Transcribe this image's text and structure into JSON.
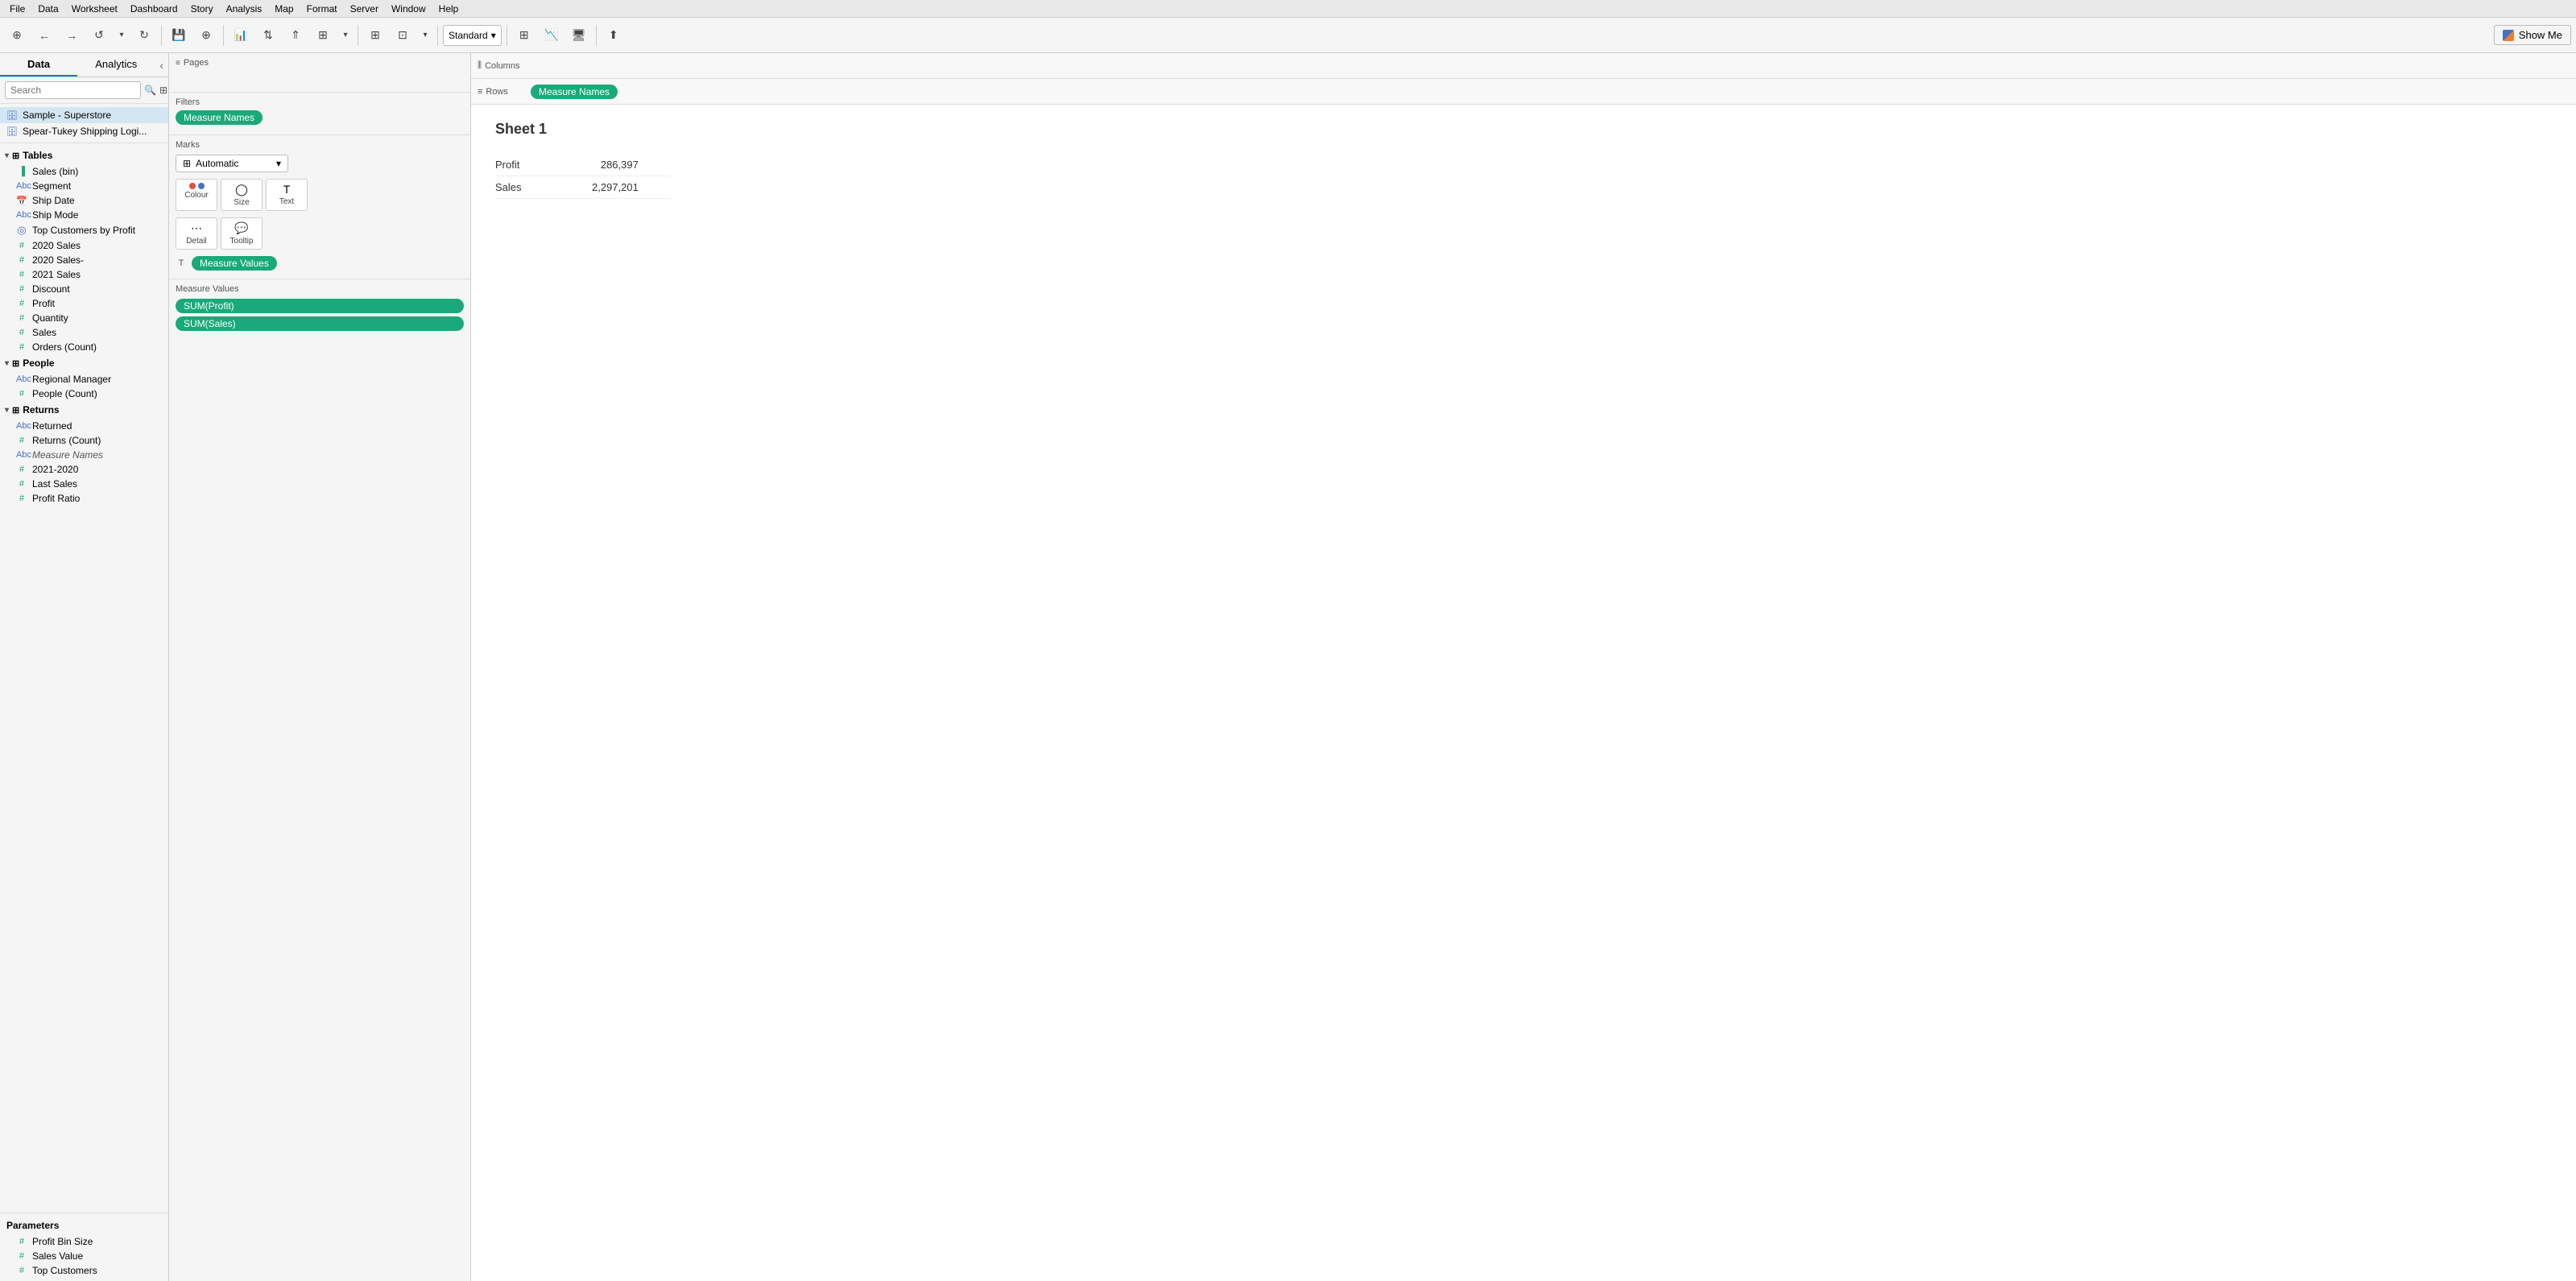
{
  "menubar": {
    "items": [
      "File",
      "Data",
      "Worksheet",
      "Dashboard",
      "Story",
      "Analysis",
      "Map",
      "Format",
      "Server",
      "Window",
      "Help"
    ]
  },
  "toolbar": {
    "show_me_label": "Show Me",
    "marks_type_label": "Automatic",
    "standard_label": "Standard"
  },
  "left_panel": {
    "tab_data": "Data",
    "tab_analytics": "Analytics",
    "search_placeholder": "Search",
    "data_sources": [
      {
        "label": "Sample - Superstore",
        "active": true
      },
      {
        "label": "Spear-Tukey Shipping Logi..."
      }
    ],
    "tables_header": "Tables",
    "fields": [
      {
        "name": "Sales (bin)",
        "type": "meas",
        "icon": "bar"
      },
      {
        "name": "Segment",
        "type": "dim",
        "icon": "abc"
      },
      {
        "name": "Ship Date",
        "type": "date",
        "icon": "cal"
      },
      {
        "name": "Ship Mode",
        "type": "dim",
        "icon": "abc"
      },
      {
        "name": "Top Customers by Profit",
        "type": "dim",
        "icon": "set"
      },
      {
        "name": "2020 Sales",
        "type": "meas",
        "icon": "hash"
      },
      {
        "name": "2020 Sales-",
        "type": "meas",
        "icon": "hash"
      },
      {
        "name": "2021 Sales",
        "type": "meas",
        "icon": "hash"
      },
      {
        "name": "Discount",
        "type": "meas",
        "icon": "hash"
      },
      {
        "name": "Profit",
        "type": "meas",
        "icon": "hash"
      },
      {
        "name": "Quantity",
        "type": "meas",
        "icon": "hash"
      },
      {
        "name": "Sales",
        "type": "meas",
        "icon": "hash"
      },
      {
        "name": "Orders (Count)",
        "type": "meas",
        "icon": "hash"
      }
    ],
    "people_header": "People",
    "people_fields": [
      {
        "name": "Regional Manager",
        "type": "dim",
        "icon": "abc"
      },
      {
        "name": "People (Count)",
        "type": "meas",
        "icon": "hash"
      }
    ],
    "returns_header": "Returns",
    "returns_fields": [
      {
        "name": "Returned",
        "type": "dim",
        "icon": "abc"
      },
      {
        "name": "Returns (Count)",
        "type": "meas",
        "icon": "hash"
      }
    ],
    "extra_fields": [
      {
        "name": "Measure Names",
        "type": "dim",
        "icon": "abc",
        "italic": true
      },
      {
        "name": "2021-2020",
        "type": "meas",
        "icon": "hash"
      },
      {
        "name": "Last Sales",
        "type": "meas",
        "icon": "hash"
      },
      {
        "name": "Profit Ratio",
        "type": "meas",
        "icon": "hash",
        "partial": true
      }
    ],
    "parameters_label": "Parameters",
    "parameters": [
      {
        "name": "Profit Bin Size",
        "icon": "hash"
      },
      {
        "name": "Sales Value",
        "icon": "hash"
      },
      {
        "name": "Top Customers",
        "icon": "hash"
      }
    ]
  },
  "shelves": {
    "pages_label": "Pages",
    "filters_label": "Filters",
    "filters_pill": "Measure Names",
    "marks_label": "Marks",
    "marks_type": "Automatic",
    "colour_label": "Colour",
    "size_label": "Size",
    "text_label": "Text",
    "detail_label": "Detail",
    "tooltip_label": "Tooltip",
    "text_pill": "Measure Values",
    "measure_values_label": "Measure Values",
    "measure_values_pills": [
      "SUM(Profit)",
      "SUM(Sales)"
    ],
    "columns_label": "Columns",
    "rows_label": "Rows",
    "rows_pill": "Measure Names"
  },
  "canvas": {
    "sheet_title": "Sheet 1",
    "table_rows": [
      {
        "label": "Profit",
        "value": "286,397"
      },
      {
        "label": "Sales",
        "value": "2,297,201"
      }
    ]
  }
}
